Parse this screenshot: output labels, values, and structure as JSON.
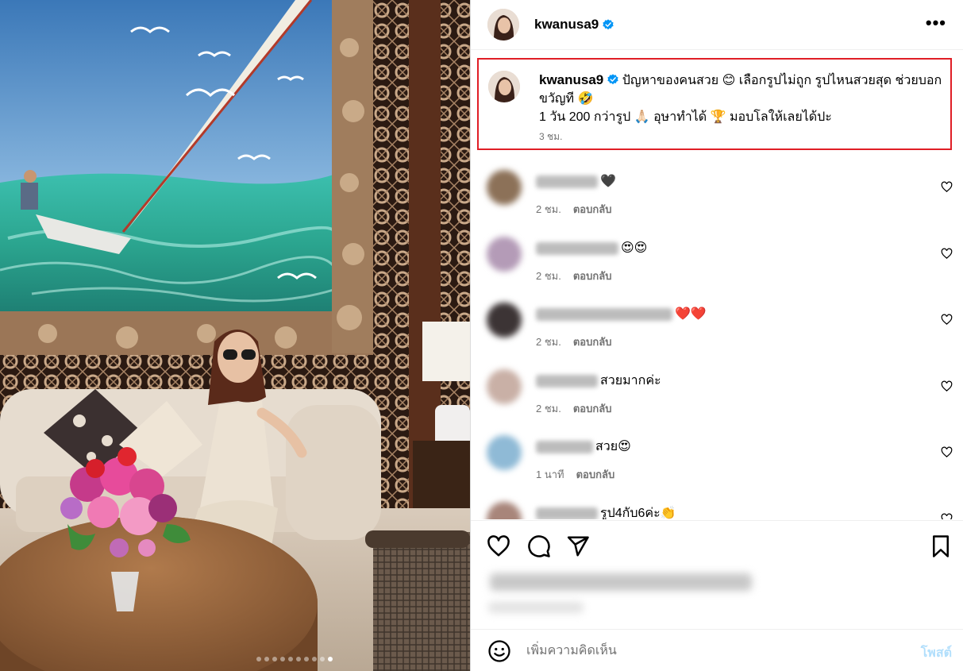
{
  "post": {
    "username": "kwanusa9",
    "verified_icon": "verified-badge-icon",
    "more_icon": "more-options-icon",
    "more_label": "•••",
    "carousel": {
      "total_slides": 10,
      "active_slide": 10
    }
  },
  "caption": {
    "username": "kwanusa9",
    "line1": "ปัญหาของคนสวย 😊 เลือกรูปไม่ถูก รูปไหนสวยสุด ช่วยบอกขวัญที 🤣",
    "line2": "1 วัน 200 กว่ารูป 🙏🏻 อุษาทำได้ 🏆 มอบโลให้เลยได้ปะ",
    "time": "3 ชม."
  },
  "comments": [
    {
      "text": "🖤",
      "time": "2 ชม.",
      "reply": "ตอบกลับ",
      "name_width": 78
    },
    {
      "text": "😍😍",
      "time": "2 ชม.",
      "reply": "ตอบกลับ",
      "name_width": 104
    },
    {
      "text": "❤️❤️",
      "time": "2 ชม.",
      "reply": "ตอบกลับ",
      "name_width": 172
    },
    {
      "text": "สวยมากค่ะ",
      "time": "2 ชม.",
      "reply": "ตอบกลับ",
      "name_width": 78
    },
    {
      "text": "สวย😍",
      "time": "1 นาที",
      "reply": "ตอบกลับ",
      "name_width": 72
    },
    {
      "text": "รูป4กับ6ค่ะ👏",
      "time": "",
      "reply": "",
      "name_width": 78
    }
  ],
  "actions": {
    "like_icon": "heart-icon",
    "comment_icon": "comment-icon",
    "share_icon": "send-icon",
    "save_icon": "bookmark-icon"
  },
  "add_comment": {
    "emoji_icon": "emoji-icon",
    "placeholder": "เพิ่มความคิดเห็น",
    "post_label": "โพสต์"
  },
  "colors": {
    "highlight_border": "#e01e26",
    "verified_blue": "#0095f6",
    "post_button_disabled": "#b2dffc",
    "meta_gray": "#737373"
  }
}
